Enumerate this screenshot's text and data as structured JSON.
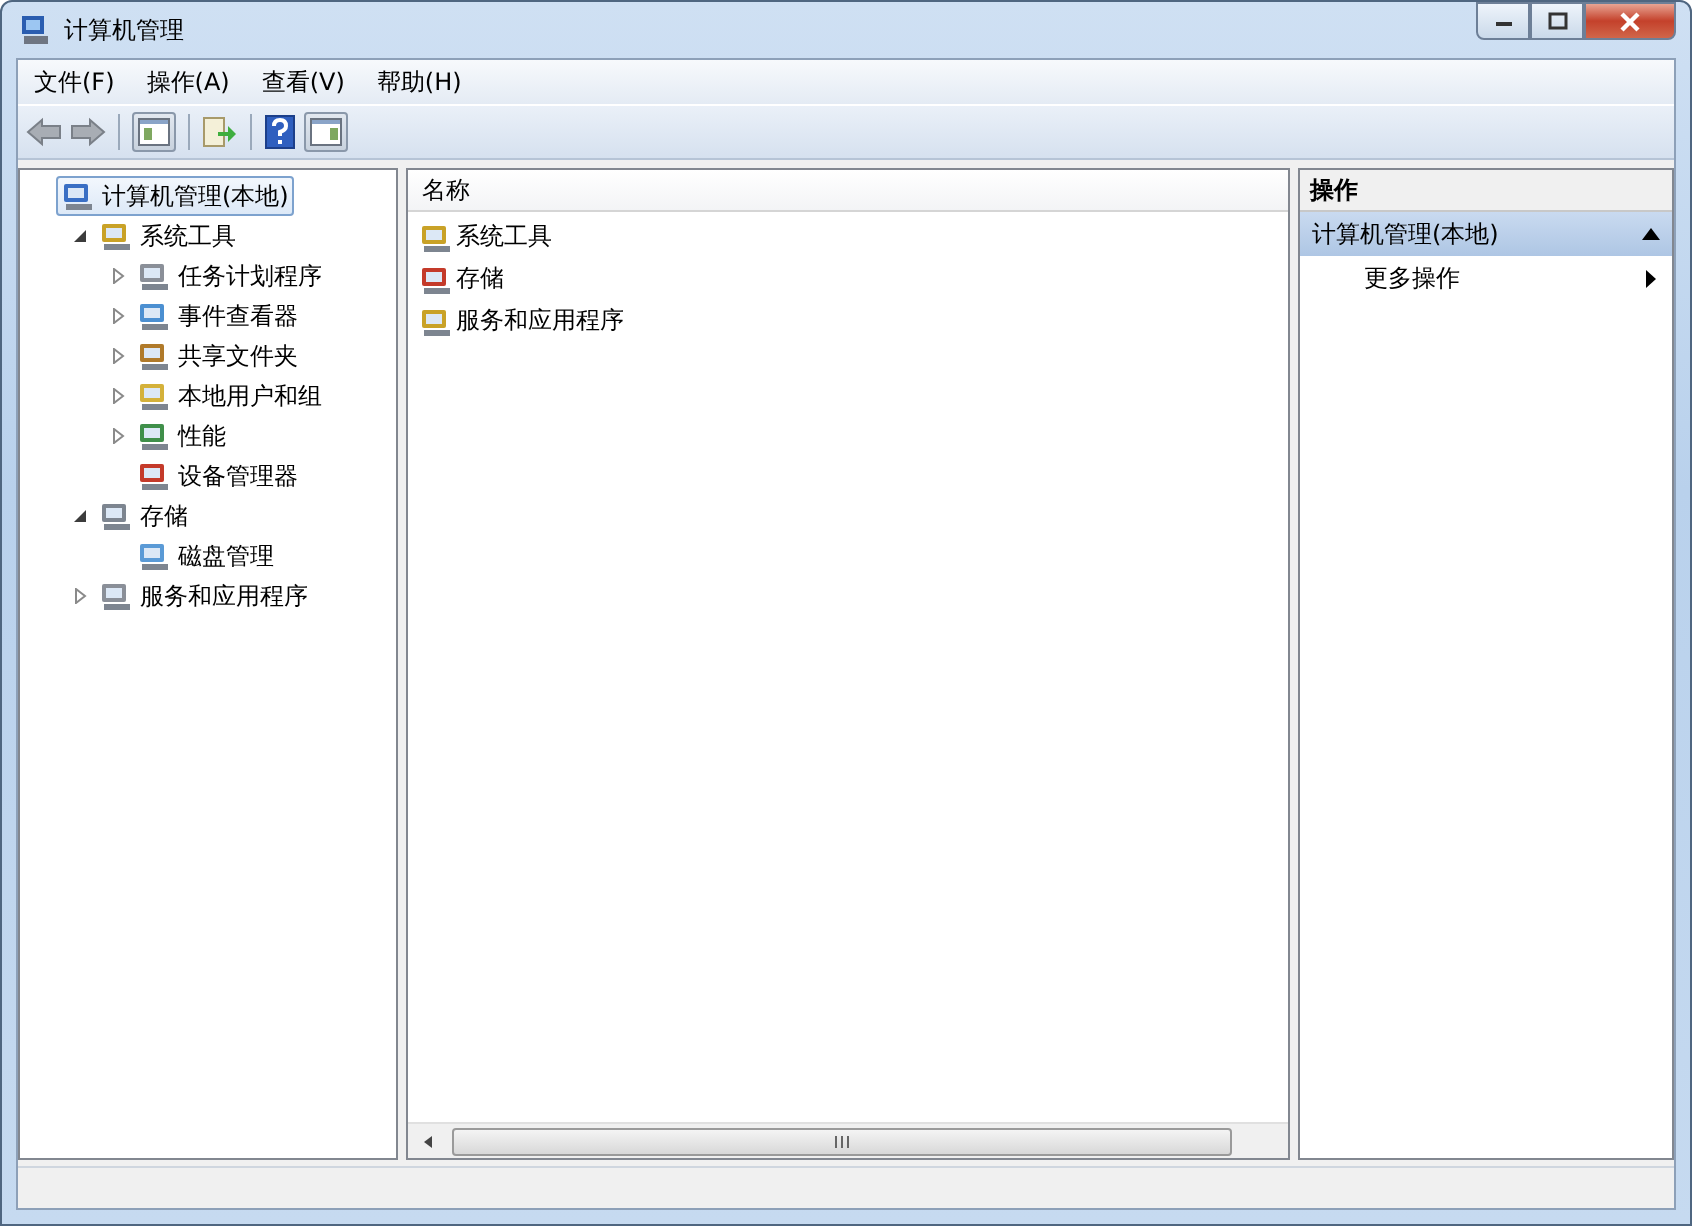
{
  "window": {
    "title": "计算机管理"
  },
  "menu": [
    {
      "label": "文件(F)"
    },
    {
      "label": "操作(A)"
    },
    {
      "label": "查看(V)"
    },
    {
      "label": "帮助(H)"
    }
  ],
  "tree": [
    {
      "label": "计算机管理(本地)",
      "selected": true,
      "children": [
        {
          "label": "系统工具",
          "selected": false,
          "expanded": true,
          "children": [
            {
              "label": "任务计划程序",
              "selected": false,
              "expanded": false
            },
            {
              "label": "事件查看器",
              "selected": false,
              "expanded": false
            },
            {
              "label": "共享文件夹",
              "selected": false,
              "expanded": false
            },
            {
              "label": "本地用户和组",
              "selected": false,
              "expanded": false
            },
            {
              "label": "性能",
              "selected": false,
              "expanded": false
            },
            {
              "label": "设备管理器",
              "selected": false
            }
          ]
        },
        {
          "label": "存储",
          "selected": false,
          "expanded": true,
          "children": [
            {
              "label": "磁盘管理",
              "selected": false
            }
          ]
        },
        {
          "label": "服务和应用程序",
          "selected": false,
          "expanded": false
        }
      ]
    }
  ],
  "list": {
    "column": "名称",
    "items": [
      {
        "label": "系统工具"
      },
      {
        "label": "存储"
      },
      {
        "label": "服务和应用程序"
      }
    ]
  },
  "actions": {
    "title": "操作",
    "section": "计算机管理(本地)",
    "items": [
      {
        "label": "更多操作"
      }
    ]
  }
}
